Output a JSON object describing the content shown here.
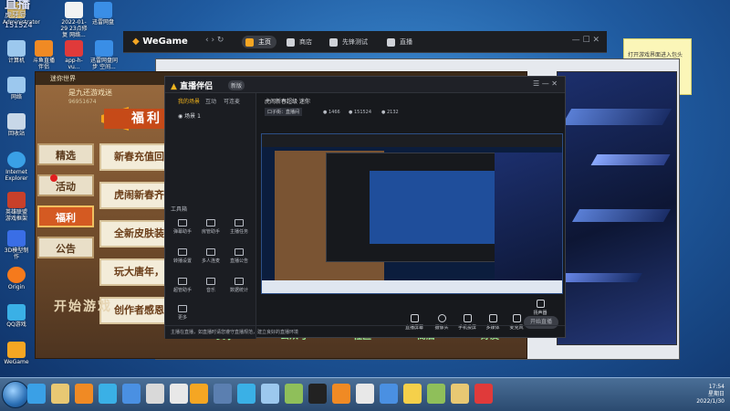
{
  "watermark": {
    "text": "直播",
    "label": "虎牙号",
    "number": "151524"
  },
  "desktop_icons": [
    {
      "label": "Administrator",
      "icon": "user-folder-icon",
      "color": "#e8c873"
    },
    {
      "label": "2022-01-29 23点修复 网络...",
      "icon": "document-icon",
      "color": "#f2f2f2"
    },
    {
      "label": "迅雷网盘",
      "icon": "cloud-icon",
      "color": "#3a8ee6"
    },
    {
      "label": "计算机",
      "icon": "computer-icon",
      "color": "#9cc8ee"
    },
    {
      "label": "斗鱼直播 伴侣",
      "icon": "app-icon",
      "color": "#f08a24"
    },
    {
      "label": "app-h-vu...",
      "icon": "app-icon",
      "color": "#e03a3a"
    },
    {
      "label": "迅雷网盘同步 空间...",
      "icon": "app-icon",
      "color": "#3a8ee6"
    },
    {
      "label": "网络",
      "icon": "network-icon",
      "color": "#9cc8ee"
    },
    {
      "label": "回收站",
      "icon": "recycle-bin-icon",
      "color": "#c8d8e8"
    },
    {
      "label": "Internet Explorer",
      "icon": "ie-icon",
      "color": "#3aa0e6"
    },
    {
      "label": "英雄联盟 游戏框架",
      "icon": "game-icon",
      "color": "#c8402a"
    },
    {
      "label": "3D模型制作",
      "icon": "app-icon",
      "color": "#3a6ee6"
    },
    {
      "label": "Origin",
      "icon": "origin-icon",
      "color": "#f57a1c"
    },
    {
      "label": "QQ游戏",
      "icon": "qq-game-icon",
      "color": "#3ab0e6"
    },
    {
      "label": "WeGame",
      "icon": "wegame-icon",
      "color": "#f5a623"
    }
  ],
  "sticky_note": {
    "text": "打开游戏界面进入包头 ..."
  },
  "wegame": {
    "logo": "WeGame",
    "nav": [
      "主页",
      "商店",
      "先锋测试",
      "直播"
    ]
  },
  "game": {
    "title_bar": "迷你世界",
    "player_name": "是九还游戏迷",
    "player_id": "96951674",
    "welfare": "福利",
    "tabs": [
      "精选",
      "活动",
      "福利",
      "公告"
    ],
    "active_tab": "福利",
    "cards": [
      "新春充值回馈",
      "虎闹新春齐贺",
      "全新皮肤装扮",
      "玩大唐年，赢",
      "创作者感恩福利"
    ],
    "start_button": "开始游戏",
    "bottom_nav": [
      "赛事",
      "公众号",
      "社区",
      "商店",
      "好友"
    ]
  },
  "zhibo": {
    "logo": "直播伴侣",
    "version": "新版",
    "side_tabs": [
      "我的场景",
      "互动",
      "可连麦"
    ],
    "scene_item": "场景 1",
    "tools_label": "工具箱",
    "tools": [
      "弹幕助手",
      "房管助手",
      "主播任务",
      "转播设置",
      "多人连麦",
      "直播公告",
      "超管助手",
      "音乐",
      "数据统计",
      "更多"
    ],
    "room_title": "虎闹新春超级 迷你",
    "room_tag": "口子街：直播间",
    "stats": [
      "1466",
      "151524",
      "2132"
    ],
    "controls": [
      "直播屏幕",
      "摄像头",
      "手机投屏",
      "多媒体",
      "麦克风",
      "扬声器"
    ],
    "go_live": "开始直播",
    "footer": "主播在直播，如直播时请您遵守直播规范，建立良好的直播环境"
  },
  "taskbar": {
    "icons": [
      "ie-icon",
      "folder-icon",
      "media-icon",
      "qq-icon",
      "browser-icon",
      "notes-icon",
      "wegame-icon",
      "tool-icon",
      "game-icon",
      "network-icon",
      "box-icon",
      "terminal-icon",
      "app-icon",
      "mouse-icon",
      "photo-icon",
      "image-icon",
      "live-icon"
    ],
    "time": "17:54",
    "weekday": "星期日",
    "date": "2022/1/30"
  }
}
